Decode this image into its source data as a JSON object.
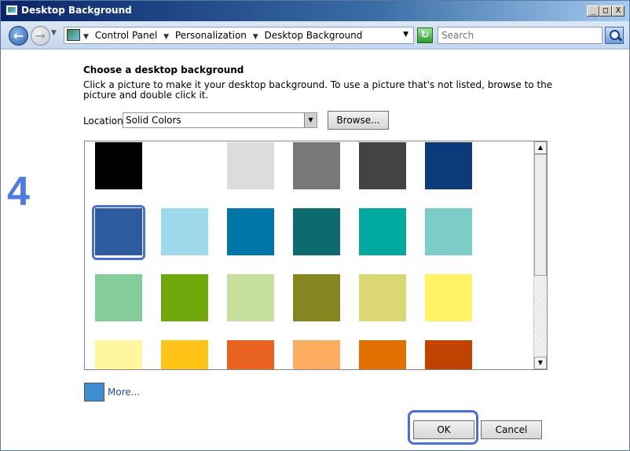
{
  "window": {
    "title": "Desktop Background",
    "controls": {
      "minimize": "_",
      "maximize": "□",
      "close": "X"
    }
  },
  "navbar": {
    "breadcrumbs": [
      "Control Panel",
      "Personalization",
      "Desktop Background"
    ],
    "search_placeholder": "Search"
  },
  "step_label": "4",
  "main": {
    "heading": "Choose a desktop background",
    "description": "Click a picture to make it your desktop background. To use a picture that's not listed, browse to the picture and double click it.",
    "location_label": "Location",
    "location_value": "Solid Colors",
    "browse_label": "Browse..."
  },
  "swatches": [
    [
      "#000000",
      "#ffffff",
      "#dcdcdc",
      "#787878",
      "#434343",
      "#0c3a7a"
    ],
    [
      "#2d5b9e",
      "#9dd9ea",
      "#0076a8",
      "#0d6b6f",
      "#00a89f",
      "#7ccdc8"
    ],
    [
      "#85cc9d",
      "#70a70a",
      "#c6df9d",
      "#85861f",
      "#dcd775",
      "#fff363"
    ],
    [
      "#fff6a0",
      "#ffc318",
      "#e86320",
      "#fcad5f",
      "#e17000",
      "#c04400"
    ]
  ],
  "selected_swatch": {
    "row": 1,
    "col": 0
  },
  "more": {
    "color": "#3e8ed0",
    "label": "More..."
  },
  "buttons": {
    "ok": "OK",
    "cancel": "Cancel"
  }
}
